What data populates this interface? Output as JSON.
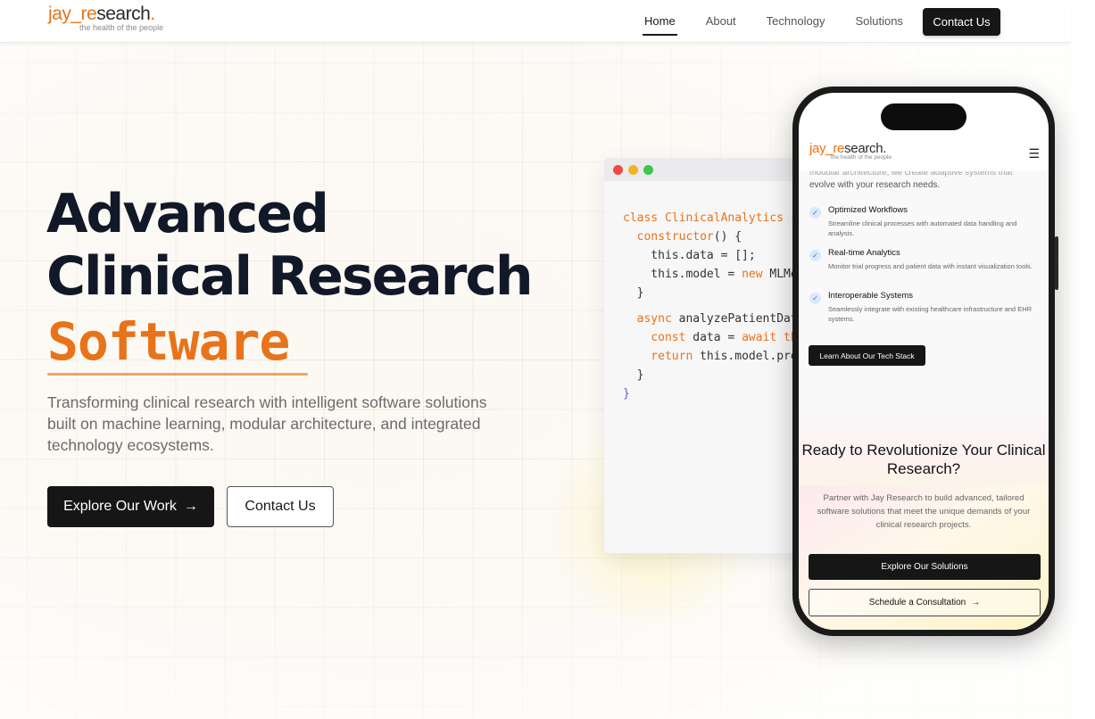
{
  "brand": {
    "logo_part1": "jay_",
    "logo_part2": "re",
    "logo_part3": "search",
    "logo_part4": ".",
    "tagline": "the health of the people",
    "accent_color": "#e8731a",
    "dark_color": "#161616"
  },
  "nav": {
    "links": [
      {
        "label": "Home",
        "active": true
      },
      {
        "label": "About"
      },
      {
        "label": "Technology"
      },
      {
        "label": "Solutions"
      }
    ],
    "cta_label": "Contact Us"
  },
  "hero": {
    "title_line1": "Advanced",
    "title_line2": "Clinical Research",
    "title_accent": "Software",
    "subtitle": "Transforming clinical research with intelligent software solutions built on machine learning, modular architecture, and integrated technology ecosystems.",
    "primary_button": "Explore Our Work",
    "primary_button_icon": "arrow-right-icon",
    "secondary_button": "Contact Us"
  },
  "code_window": {
    "lines": [
      {
        "a": "class ",
        "b": "ClinicalAnalytics",
        "c": " {"
      },
      {
        "a": "  constructor",
        "b": "() {",
        "c": ""
      },
      {
        "a": "    this.data = [];",
        "b": "",
        "c": ""
      },
      {
        "a": "    this.model = ",
        "b": "new",
        "c": " MLModel"
      },
      {
        "a": "  }",
        "b": "",
        "c": ""
      },
      {
        "a": "",
        "b": "",
        "c": ""
      },
      {
        "a": "  async",
        "b": " analyzePatientData",
        "c": ""
      },
      {
        "a": "    const",
        "b": " data = ",
        "c": "await this"
      },
      {
        "a": "    return",
        "b": " this.model.predict",
        "c": ""
      },
      {
        "a": "  }",
        "b": "",
        "c": ""
      },
      {
        "a": "}",
        "b": "",
        "c": ""
      }
    ]
  },
  "phone": {
    "logo_part1": "jay_",
    "logo_part2": "re",
    "logo_part3": "search.",
    "tagline": "the health of the people",
    "menu_icon": "hamburger-icon",
    "cut_text": "modular architecture, we create adaptive systems that",
    "intro": "evolve with your research needs.",
    "features": [
      {
        "title": "Optimized Workflows",
        "desc": "Streamline clinical processes with automated data handling and analysis."
      },
      {
        "title": "Real-time Analytics",
        "desc": "Monitor trial progress and patient data with instant visualization tools."
      },
      {
        "title": "Interoperable Systems",
        "desc": "Seamlessly integrate with existing healthcare infrastructure and EHR systems."
      }
    ],
    "tech_button": "Learn About Our Tech Stack",
    "cta_title": "Ready to Revolutionize Your Clinical Research?",
    "cta_text": "Partner with Jay Research to build advanced, tailored software solutions that meet the unique demands of your clinical research projects.",
    "btn_solutions": "Explore Our Solutions",
    "btn_consult": "Schedule a Consultation",
    "btn_consult_icon": "arrow-right-icon"
  }
}
